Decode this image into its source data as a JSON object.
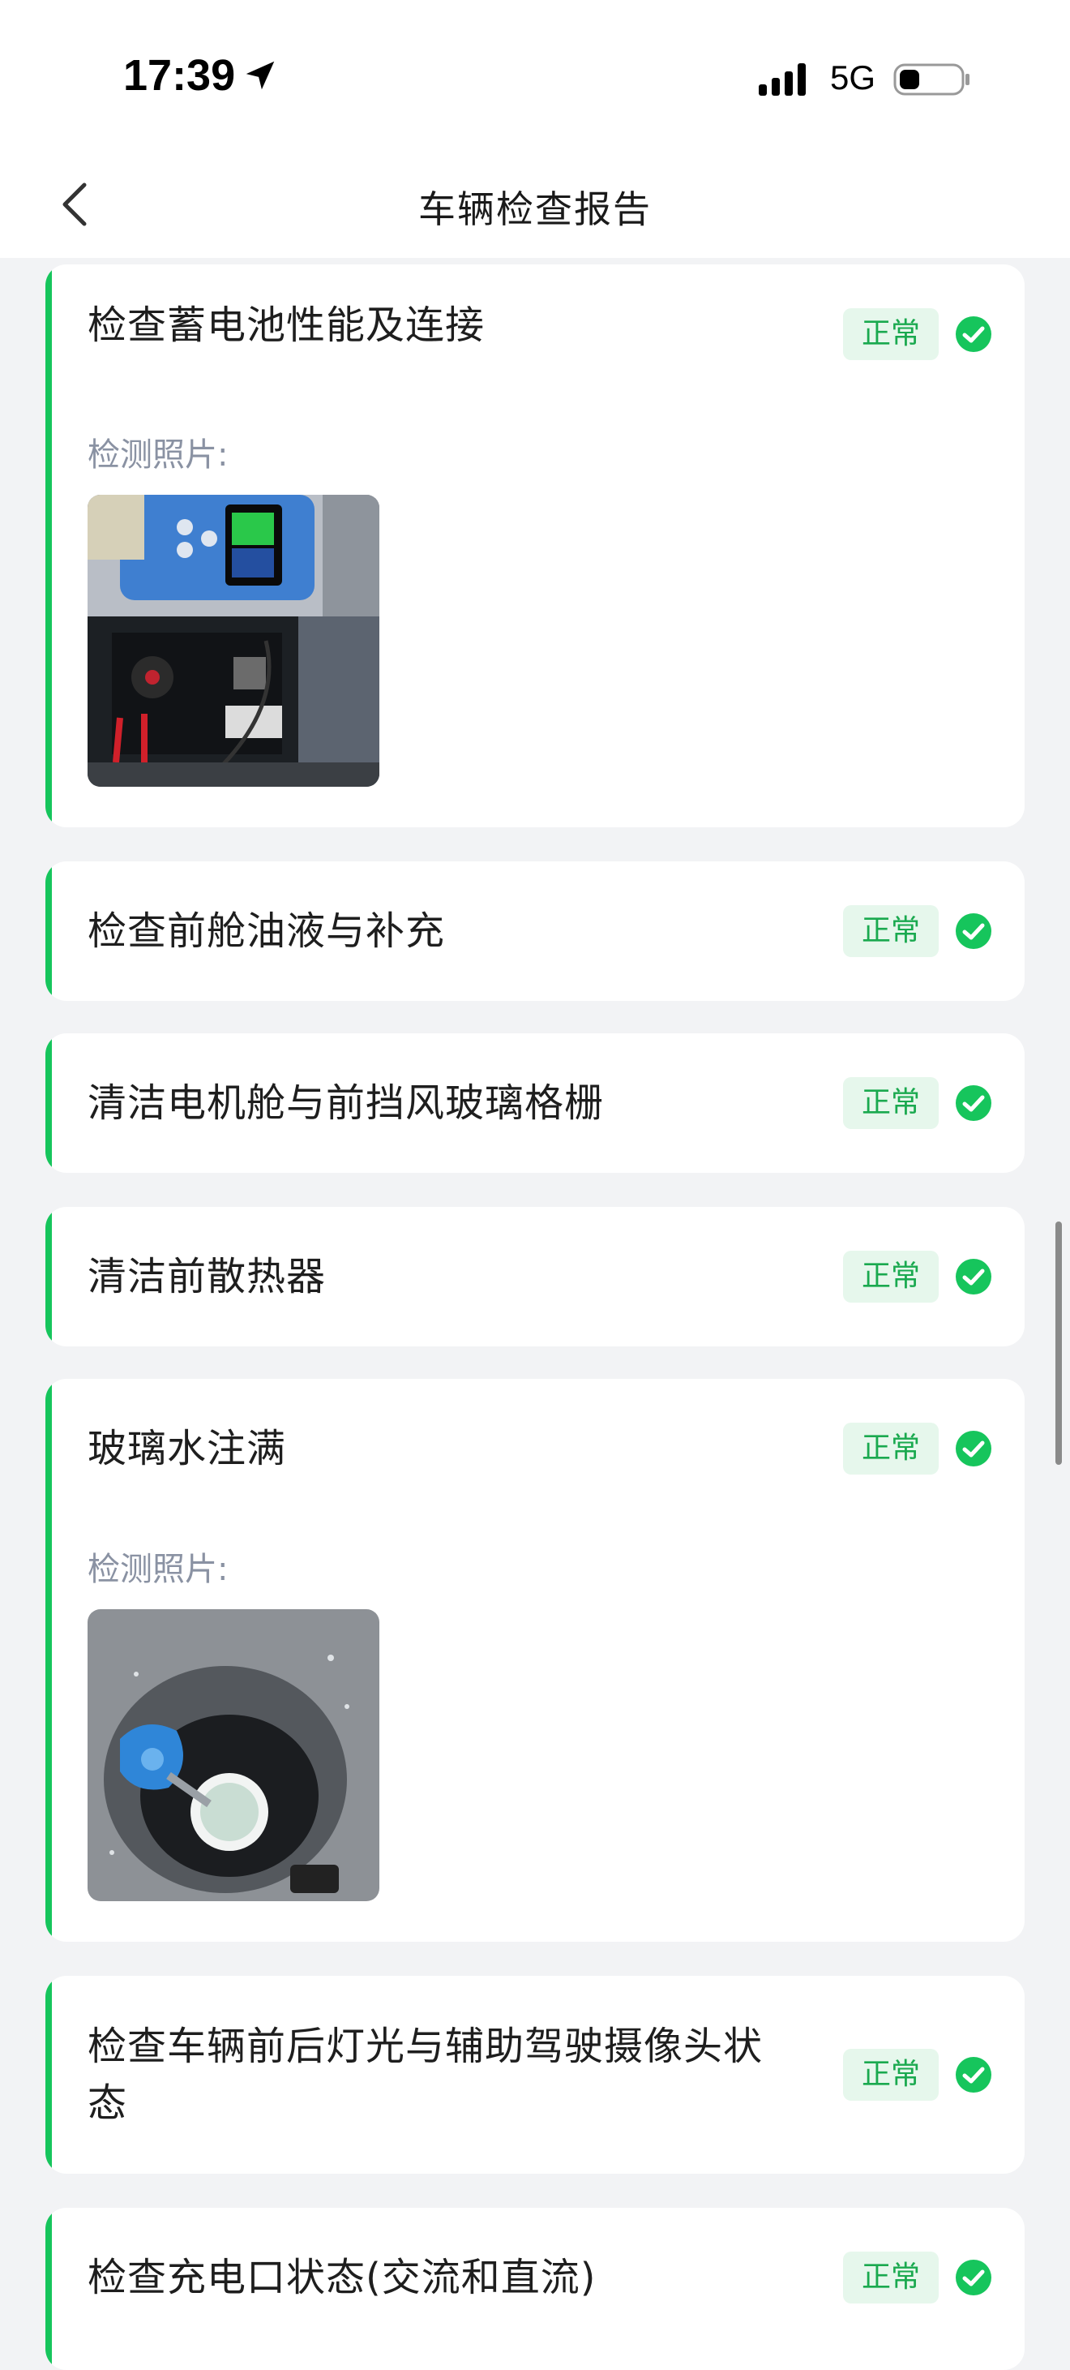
{
  "status_bar": {
    "time": "17:39",
    "network": "5G"
  },
  "header": {
    "title": "车辆检查报告"
  },
  "items": [
    {
      "title": "检查蓄电池性能及连接",
      "status": "正常",
      "photo_label": "检测照片:"
    },
    {
      "title": "检查前舱油液与补充",
      "status": "正常"
    },
    {
      "title": "清洁电机舱与前挡风玻璃格栅",
      "status": "正常"
    },
    {
      "title": "清洁前散热器",
      "status": "正常"
    },
    {
      "title": "玻璃水注满",
      "status": "正常",
      "photo_label": "检测照片:"
    },
    {
      "title_line1": "检查车辆前后灯光与辅助驾驶摄像头状",
      "title_line2": "态",
      "status": "正常"
    },
    {
      "title": "检查充电口状态(交流和直流)",
      "status": "正常"
    }
  ],
  "colors": {
    "accent": "#16c55c",
    "badge_bg": "#e6f7ec",
    "badge_text": "#1aa94f"
  }
}
